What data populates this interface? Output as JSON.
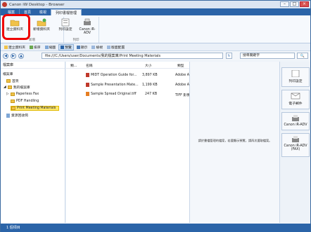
{
  "window": {
    "title": "Canon iW Desktop - Browser"
  },
  "ribbon_tabs": [
    "檔案",
    "首頁",
    "檢視",
    "列印書檔管理"
  ],
  "ribbon": {
    "groups": [
      {
        "name": "新增",
        "buttons": [
          "建立資料夾",
          "新增資料夾"
        ]
      },
      {
        "name": "列印",
        "buttons": [
          "列印設定",
          "Canon iR-ADV"
        ]
      }
    ],
    "highlighted_button": "建立資料夾"
  },
  "toolbar2": [
    "建立資料夾",
    "排序",
    "縮圖",
    "預覽",
    "顯示",
    "檢視",
    "版面配置"
  ],
  "address": {
    "path": "file:///C:/Users/user/Documents/我的檔案庫/Print Meeting Materials",
    "search_placeholder": "搜尋關鍵字"
  },
  "tree": {
    "header": "檔案庫",
    "items": [
      "檔案庫",
      "首頁",
      "我的檔案庫",
      "Paperless Fax",
      "PDF Handling",
      "Print Meeting Materials",
      "資源回收筒"
    ]
  },
  "list": {
    "headers": {
      "type": "類...",
      "name": "名稱",
      "size": "大小",
      "kind": "類型"
    },
    "rows": [
      {
        "name": "MIDT Operation Guide for...",
        "size": "3,897 KB",
        "kind": "Adobe A..."
      },
      {
        "name": "Sample Presentation Mate...",
        "size": "1,199 KB",
        "kind": "Adobe A..."
      },
      {
        "name": "Sample Spread Original.tiff",
        "size": "247 KB",
        "kind": "TIFF 影像"
      }
    ]
  },
  "preview": {
    "message": "請於書檔管理的檔案，若要顯示預覽，請再次選取檔案。"
  },
  "right_panel": [
    "列印設定",
    "電子郵件",
    "Canon iR-ADV",
    "Canon iR-ADV (FAX)"
  ],
  "status": {
    "text": "1 個項目"
  },
  "colors": {
    "accent": "#2b64a8",
    "highlight": "#e00000",
    "selected_folder": "#ffe86b"
  }
}
